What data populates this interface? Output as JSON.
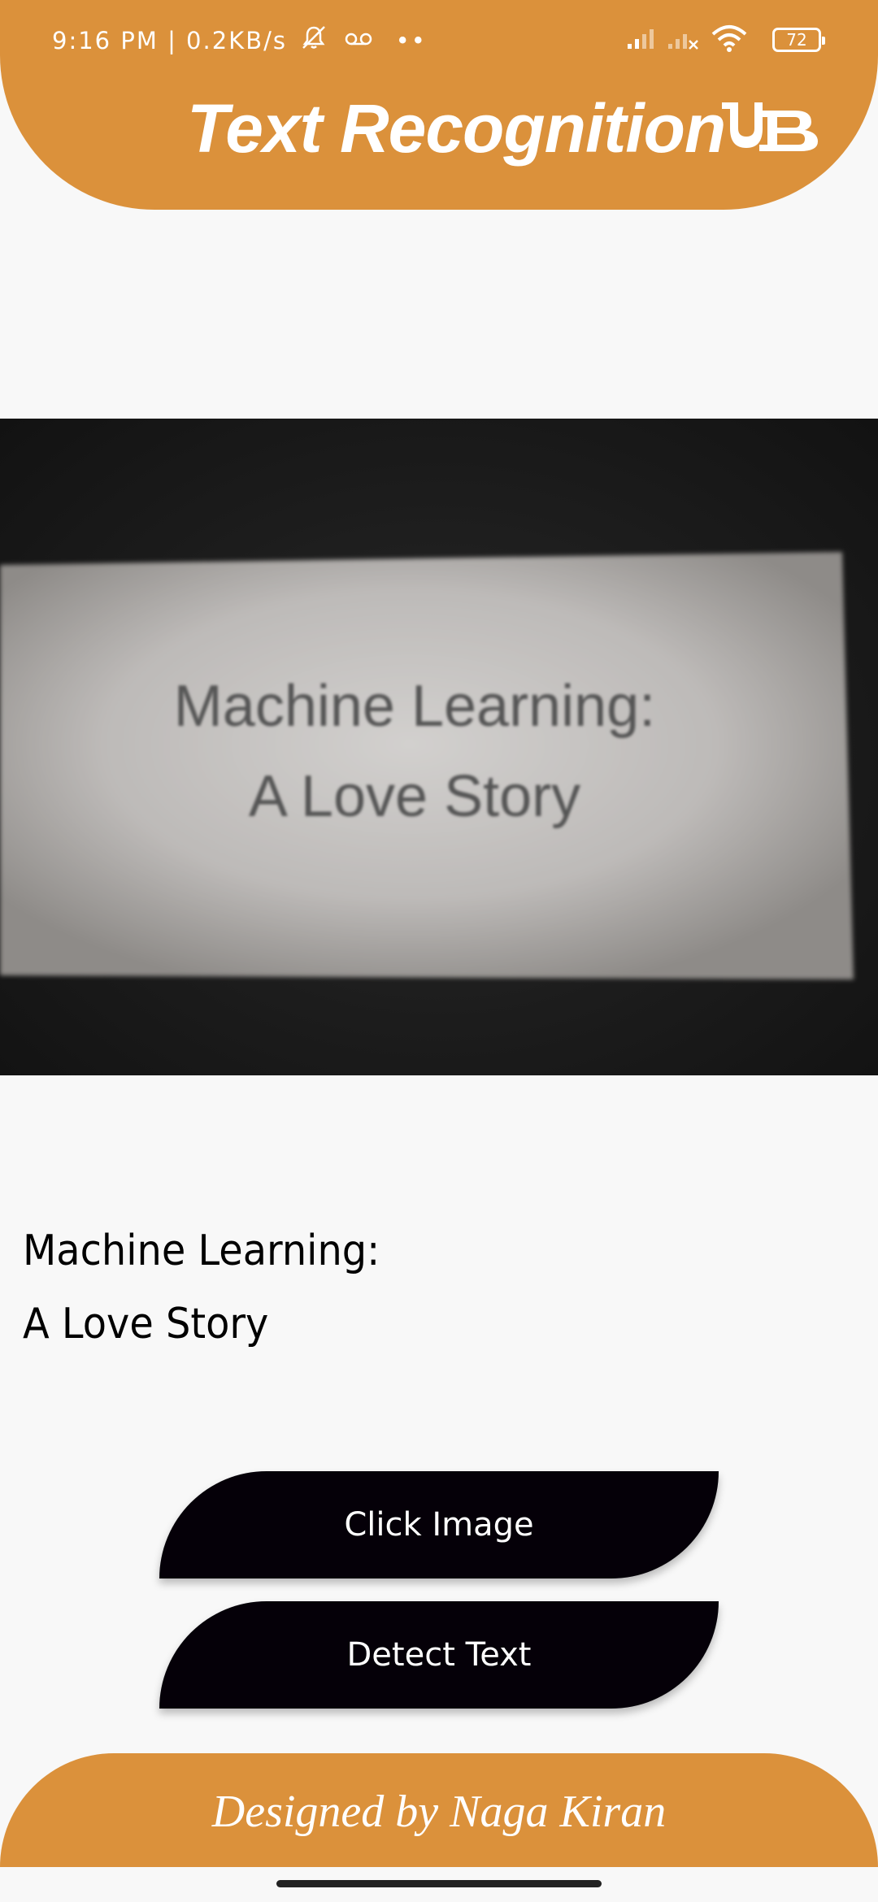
{
  "status_bar": {
    "time_speed": "9:16 PM | 0.2KB/s",
    "dots": "••",
    "battery_level": "72"
  },
  "header": {
    "title": "Text Recognition",
    "logo_icon": "ub-logo-icon"
  },
  "photo": {
    "line1": "Machine Learning:",
    "line2": "A Love Story"
  },
  "result": {
    "line1": "Machine Learning:",
    "line2": "A Love Story"
  },
  "buttons": {
    "click_image": "Click Image",
    "detect_text": "Detect Text"
  },
  "footer": {
    "credit": "Designed by Naga Kiran"
  },
  "colors": {
    "accent": "#db913b",
    "button": "#050008",
    "background": "#f8f8f8"
  }
}
